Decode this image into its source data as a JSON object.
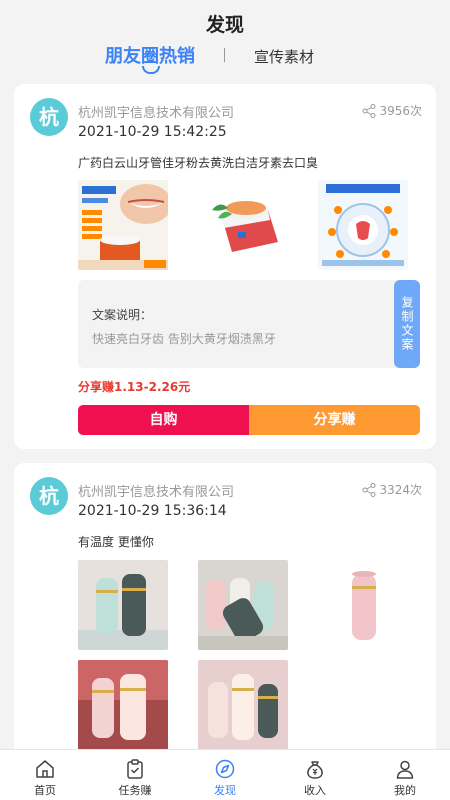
{
  "page": {
    "title": "发现"
  },
  "tabs": [
    {
      "label": "朋友圈热销",
      "active": true
    },
    {
      "label": "宣传素材",
      "active": false
    }
  ],
  "posts": [
    {
      "avatar_char": "杭",
      "company": "杭州凯宇信息技术有限公司",
      "share_count": "3956次",
      "timestamp": "2021-10-29 15:42:25",
      "text": "广药白云山牙管佳牙粉去黄洗白洁牙素去口臭",
      "images": [
        "toothpowder-product-1",
        "toothpowder-product-2",
        "toothpowder-product-3"
      ],
      "copy_label": "文案说明：",
      "copy_desc": "快速亮白牙齿 告别大黄牙烟渍黑牙",
      "copy_button": "复制文案",
      "earn_text": "分享赚1.13-2.26元",
      "buy_button": "自购",
      "share_button": "分享赚"
    },
    {
      "avatar_char": "杭",
      "company": "杭州凯宇信息技术有限公司",
      "share_count": "3324次",
      "timestamp": "2021-10-29 15:36:14",
      "text": "有温度 更懂你",
      "images": [
        "cup-product-1",
        "cup-product-2",
        "cup-product-3",
        "cup-product-4",
        "cup-product-5"
      ]
    }
  ],
  "tabbar": [
    {
      "label": "首页",
      "icon": "home-icon"
    },
    {
      "label": "任务赚",
      "icon": "task-icon"
    },
    {
      "label": "发现",
      "icon": "compass-icon",
      "active": true
    },
    {
      "label": "收入",
      "icon": "money-bag-icon"
    },
    {
      "label": "我的",
      "icon": "user-icon"
    }
  ],
  "colors": {
    "accent": "#3b82f6",
    "buy": "#f0104f",
    "share": "#ff9a33",
    "earn": "#e8392f",
    "avatar": "#5ccbd8"
  }
}
